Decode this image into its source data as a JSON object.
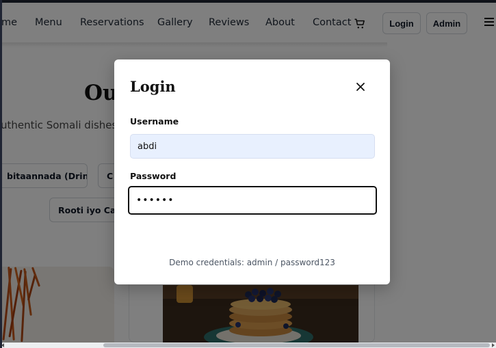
{
  "nav": {
    "links": [
      "me",
      "Menu",
      "Reservations",
      "Gallery",
      "Reviews",
      "About",
      "Contact"
    ],
    "login_label": "Login",
    "admin_label": "Admin"
  },
  "menu_section": {
    "title_fragment": "Ou",
    "subtitle_fragment": "uthentic Somali dishes",
    "chips": [
      "bitaannada (Drinks)",
      "C",
      "Rooti iyo Canj"
    ]
  },
  "modal": {
    "title": "Login",
    "username_label": "Username",
    "username_value": "abdi",
    "password_label": "Password",
    "password_value": "••••••",
    "demo_text": "Demo credentials: admin / password123"
  },
  "colors": {
    "overlay": "rgba(0,0,0,0.5)",
    "autofill_bg": "#e8f0fe",
    "focus_border": "#111111"
  },
  "icons": [
    "cart-icon",
    "close-icon",
    "menu-icon"
  ]
}
